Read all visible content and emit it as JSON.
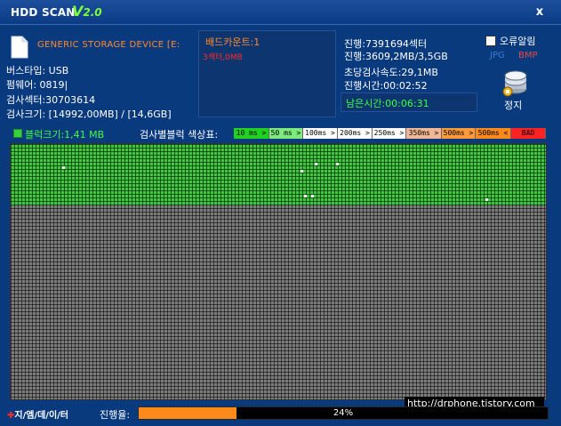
{
  "titlebar": {
    "app_name": "HDD SCAN",
    "version_prefix": "V",
    "version_number": "2.0",
    "close_label": "x"
  },
  "device": {
    "icon": "file-icon",
    "name": "GENERIC STORAGE DEVICE [E:"
  },
  "info": {
    "bus_type": "버스타입: USB",
    "firmware": "펌웨어: 0819|",
    "total_sectors": "검사섹터:30703614",
    "scan_size": "검사크기: [14992,00MB] / [14,6GB]"
  },
  "bad": {
    "count": "배드카운트:1",
    "size": "3섹터,0MB"
  },
  "stats": {
    "progress_sector": "진행:7391694섹터",
    "progress_size": "진행:3609,2MB/3,5GB",
    "speed": "초당검사속도:29,1MB",
    "elapsed": "진행시간:00:02:52",
    "remaining": "남은시간:00:06:31"
  },
  "options": {
    "error_alarm_label": "오류알림",
    "error_alarm_checked": false,
    "format_jpg": "JPG",
    "format_bmp": "BMP",
    "stop_label": "정지",
    "stop_icon": "database-stop-icon"
  },
  "legend": {
    "block_size": "블럭크기:1,41 MB",
    "title": "검사별블럭 색상표:",
    "chips": [
      {
        "label": "10 ms >",
        "color": "#22d022"
      },
      {
        "label": "50 ms >",
        "color": "#7dea7d"
      },
      {
        "label": "100ms >",
        "color": "#ffffff"
      },
      {
        "label": "200ms >",
        "color": "#ffffff"
      },
      {
        "label": "250ms >",
        "color": "#ffffff"
      },
      {
        "label": "350ms >",
        "color": "#f2b896"
      },
      {
        "label": "500ms >",
        "color": "#ff9a3a"
      },
      {
        "label": "500ms <",
        "color": "#ff8a1c"
      },
      {
        "label": "BAD",
        "color": "#ff2222"
      }
    ]
  },
  "scan_grid": {
    "done_fraction": 0.24,
    "done_color": "#3fc83f",
    "pending_color": "#7c7c7c"
  },
  "footer": {
    "watermark": "http://drphone.tistory.com",
    "brand_mark": "✚",
    "brand": "지/엠/데/이/터",
    "progress_label": "진행율:",
    "progress_percent": 24,
    "progress_text": "24%"
  }
}
